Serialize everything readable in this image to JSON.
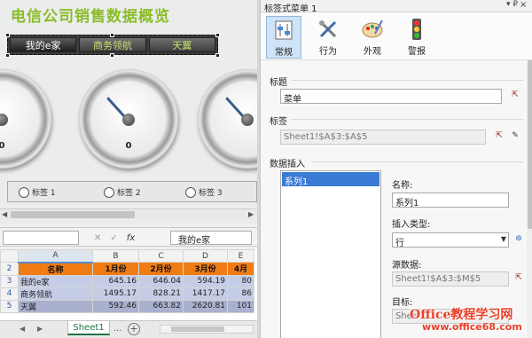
{
  "dashboard": {
    "title": "电信公司销售数据概览",
    "tabs": [
      "我的e家",
      "商务领航",
      "天翼"
    ],
    "gauges": [
      {
        "value": "0"
      },
      {
        "value": "0"
      },
      {
        "value": ""
      }
    ],
    "radios": [
      "标签 1",
      "标签 2",
      "标签 3"
    ]
  },
  "formula_bar": {
    "namebox": "",
    "cancel": "✕",
    "confirm": "✓",
    "fx": "fx",
    "value": "我的e家"
  },
  "sheet": {
    "columns": [
      "",
      "A",
      "B",
      "C",
      "D",
      "E"
    ],
    "rows": [
      {
        "num": "2",
        "cells": [
          "名称",
          "1月份",
          "2月份",
          "3月份",
          "4月"
        ]
      },
      {
        "num": "3",
        "cells": [
          "我的e家",
          "645.16",
          "646.04",
          "594.19",
          "80"
        ]
      },
      {
        "num": "4",
        "cells": [
          "商务领航",
          "1495.17",
          "828.21",
          "1417.17",
          "86"
        ]
      },
      {
        "num": "5",
        "cells": [
          "天翼",
          "592.46",
          "663.82",
          "2620.81",
          "101"
        ]
      }
    ],
    "tab": "Sheet1",
    "more": "...",
    "add": "+"
  },
  "panel": {
    "title": "标签式菜单 1",
    "pin": "▾ ₽",
    "close": "×",
    "tools": [
      "常规",
      "行为",
      "外观",
      "警报"
    ],
    "section_caption": "标题",
    "caption_value": "菜单",
    "section_tags": "标签",
    "tags_value": "Sheet1!$A$3:$A$5",
    "section_data": "数据插入",
    "series": [
      "系列1"
    ],
    "name_label": "名称:",
    "name_value": "系列1",
    "insert_type_label": "插入类型:",
    "insert_type_value": "行",
    "source_label": "源数据:",
    "source_value": "Sheet1!$A$3:$M$5",
    "target_label": "目标:",
    "target_value": "Shee"
  },
  "watermark": {
    "line1": "Office教程学习网",
    "line2": "www.office68.com"
  },
  "colors": {
    "title_green": "#8bbd2a",
    "header_orange": "#f07c16",
    "row_blue": "#c5cde6",
    "selection_blue": "#3a7bd5",
    "watermark_red": "#e8402a"
  }
}
